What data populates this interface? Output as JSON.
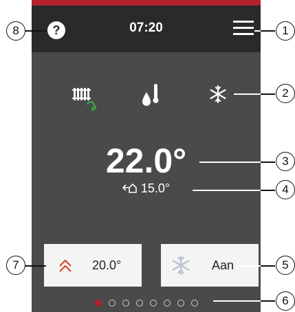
{
  "header": {
    "time": "07:20",
    "help_label": "?"
  },
  "modes": [
    "radiator-sync-icon",
    "water-temperature-icon",
    "snowflake-icon"
  ],
  "main": {
    "current_temp": "22.0°",
    "outdoor_temp": "15.0°"
  },
  "cards": {
    "setpoint": {
      "value": "20.0°",
      "icon": "chevron-up-double-icon"
    },
    "cooling": {
      "value": "Aan",
      "icon": "snowflake-icon"
    }
  },
  "pager": {
    "total": 8,
    "active": 1
  },
  "callouts": [
    "1",
    "2",
    "3",
    "4",
    "5",
    "6",
    "7",
    "8"
  ],
  "colors": {
    "accent": "#b5202e",
    "header": "#2a2a2a",
    "screen": "#4a4a4a",
    "card": "#f4f4f4"
  }
}
